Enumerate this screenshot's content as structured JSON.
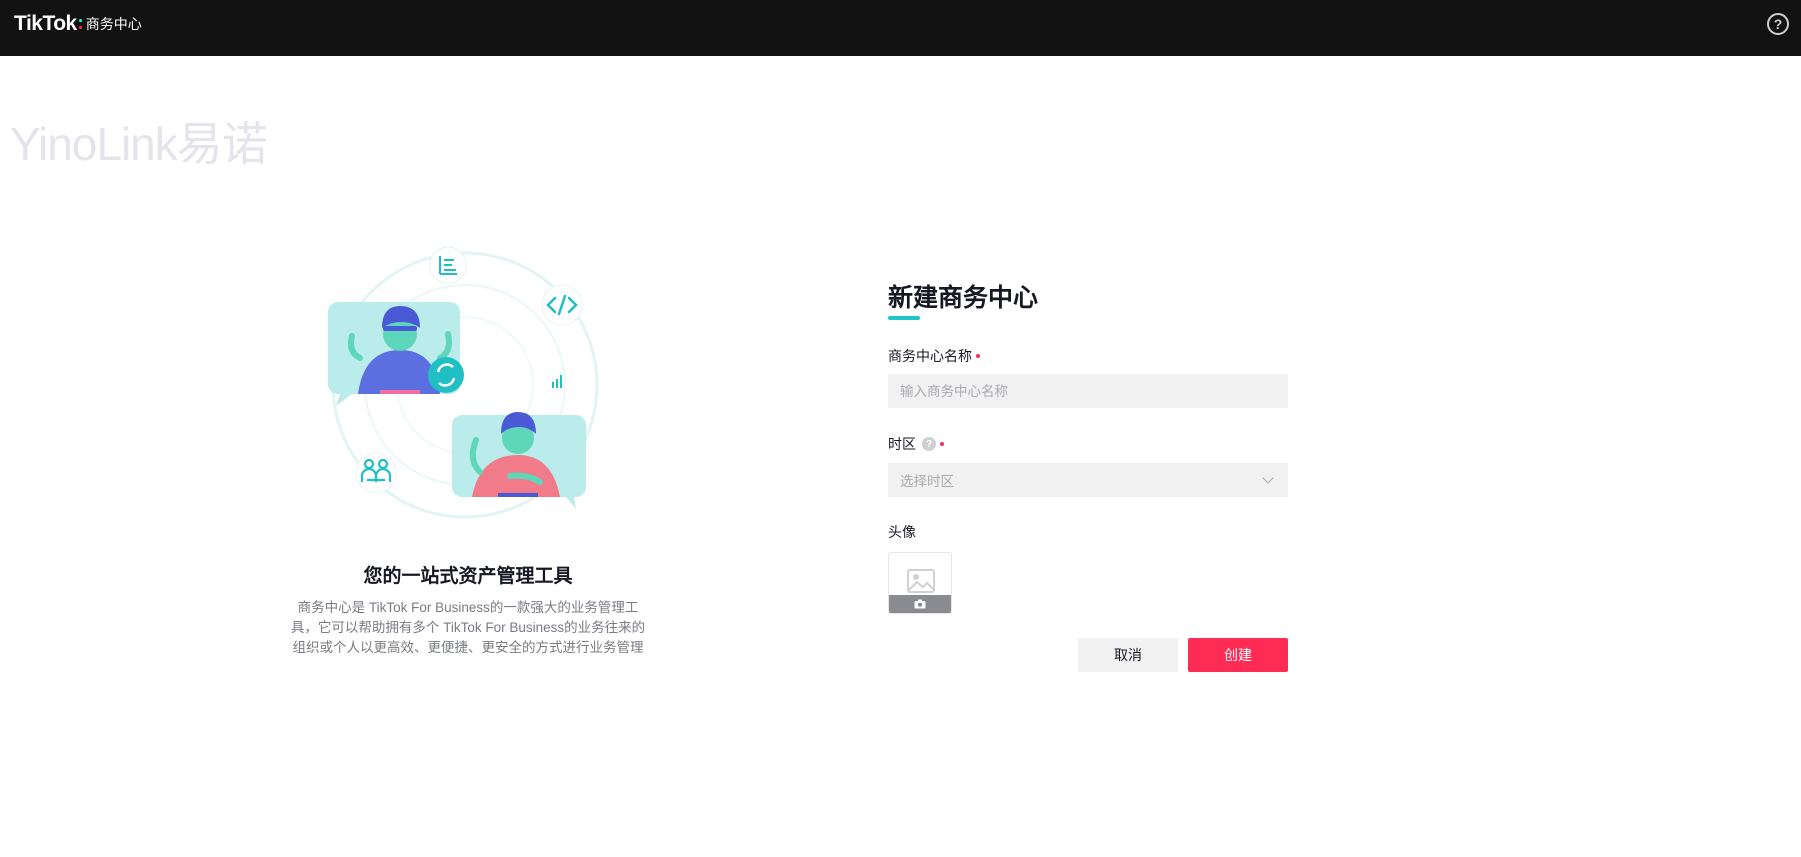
{
  "header": {
    "logo_text": "TikTok",
    "product_name": "商务中心",
    "help_symbol": "?",
    "help_icon": "question-circle-icon"
  },
  "watermark": {
    "text": "YinoLink易诺"
  },
  "intro": {
    "title": "您的一站式资产管理工具",
    "description": "商务中心是 TikTok For Business的一款强大的业务管理工具，它可以帮助拥有多个 TikTok For Business的业务往来的组织或个人以更高效、更便捷、更安全的方式进行业务管理"
  },
  "form": {
    "title": "新建商务中心",
    "name_field": {
      "label": "商务中心名称",
      "placeholder": "输入商务中心名称",
      "value": ""
    },
    "timezone_field": {
      "label": "时区",
      "help_symbol": "?",
      "placeholder": "选择时区"
    },
    "avatar_field": {
      "label": "头像"
    },
    "cancel_label": "取消",
    "create_label": "创建"
  },
  "colors": {
    "topbar": "#121212",
    "primary": "#FE2C55",
    "accent": "#20C4CB",
    "input_bg": "#F1F1F2"
  }
}
